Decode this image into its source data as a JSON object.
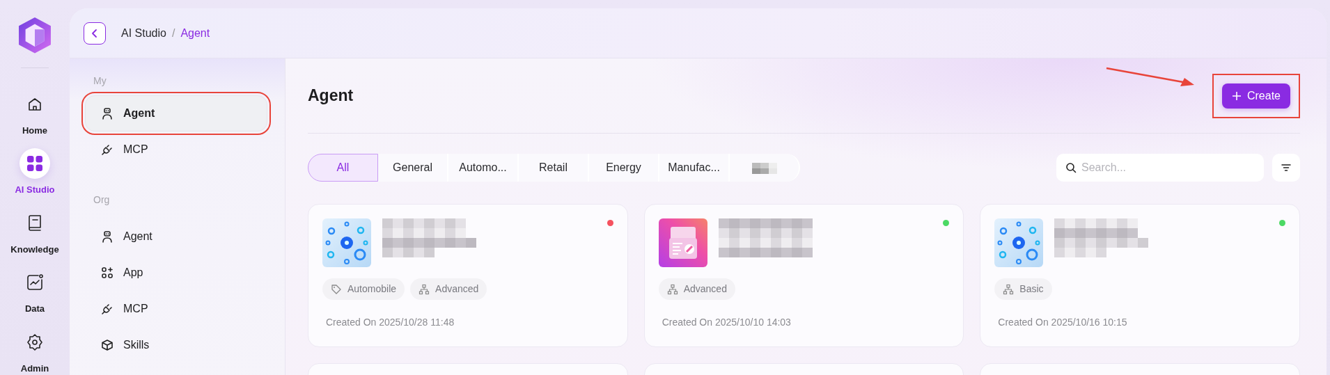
{
  "rail": {
    "items": [
      {
        "label": "Home",
        "kind": "home",
        "selected": false
      },
      {
        "label": "AI Studio",
        "kind": "grid",
        "selected": true
      },
      {
        "label": "Knowledge",
        "kind": "book",
        "selected": false
      },
      {
        "label": "Data",
        "kind": "chart",
        "selected": false
      },
      {
        "label": "Admin",
        "kind": "gear",
        "selected": false
      }
    ]
  },
  "breadcrumb": {
    "items": [
      "AI Studio",
      "Agent"
    ],
    "separator": "/"
  },
  "sidebar": {
    "groups": [
      {
        "title": "My",
        "items": [
          {
            "label": "Agent",
            "kind": "robot",
            "selected": true,
            "highlighted": true
          },
          {
            "label": "MCP",
            "kind": "plug",
            "selected": false,
            "highlighted": false
          }
        ]
      },
      {
        "title": "Org",
        "items": [
          {
            "label": "Agent",
            "kind": "robot",
            "selected": false,
            "highlighted": false
          },
          {
            "label": "App",
            "kind": "apps",
            "selected": false,
            "highlighted": false
          },
          {
            "label": "MCP",
            "kind": "plug",
            "selected": false,
            "highlighted": false
          },
          {
            "label": "Skills",
            "kind": "cube",
            "selected": false,
            "highlighted": false
          }
        ]
      }
    ]
  },
  "page_title": "Agent",
  "create_button": {
    "label": "Create",
    "highlighted": true,
    "arrow": true
  },
  "tabs": [
    {
      "label": "All",
      "selected": true
    },
    {
      "label": "General",
      "selected": false
    },
    {
      "label": "Automo...",
      "selected": false
    },
    {
      "label": "Retail",
      "selected": false
    },
    {
      "label": "Energy",
      "selected": false
    },
    {
      "label": "Manufac...",
      "selected": false
    },
    {
      "kind": "redacted",
      "selected": false
    }
  ],
  "search": {
    "placeholder": "Search..."
  },
  "cards": [
    {
      "kind": "network",
      "color": "#f5515f",
      "tags": [
        {
          "kind": "tag",
          "label": "Automobile"
        },
        {
          "kind": "tree",
          "label": "Advanced"
        }
      ],
      "created": "Created On 2025/10/28 11:48"
    },
    {
      "kind": "document",
      "color": "#4cd964",
      "tags": [
        {
          "kind": "tree",
          "label": "Advanced"
        }
      ],
      "created": "Created On 2025/10/10 14:03"
    },
    {
      "kind": "network",
      "color": "#4cd964",
      "tags": [
        {
          "kind": "tree",
          "label": "Basic"
        }
      ],
      "created": "Created On 2025/10/16 10:15"
    },
    {
      "kind": "cut-off"
    },
    {
      "kind": "cut-off"
    },
    {
      "kind": "cut-off"
    }
  ]
}
